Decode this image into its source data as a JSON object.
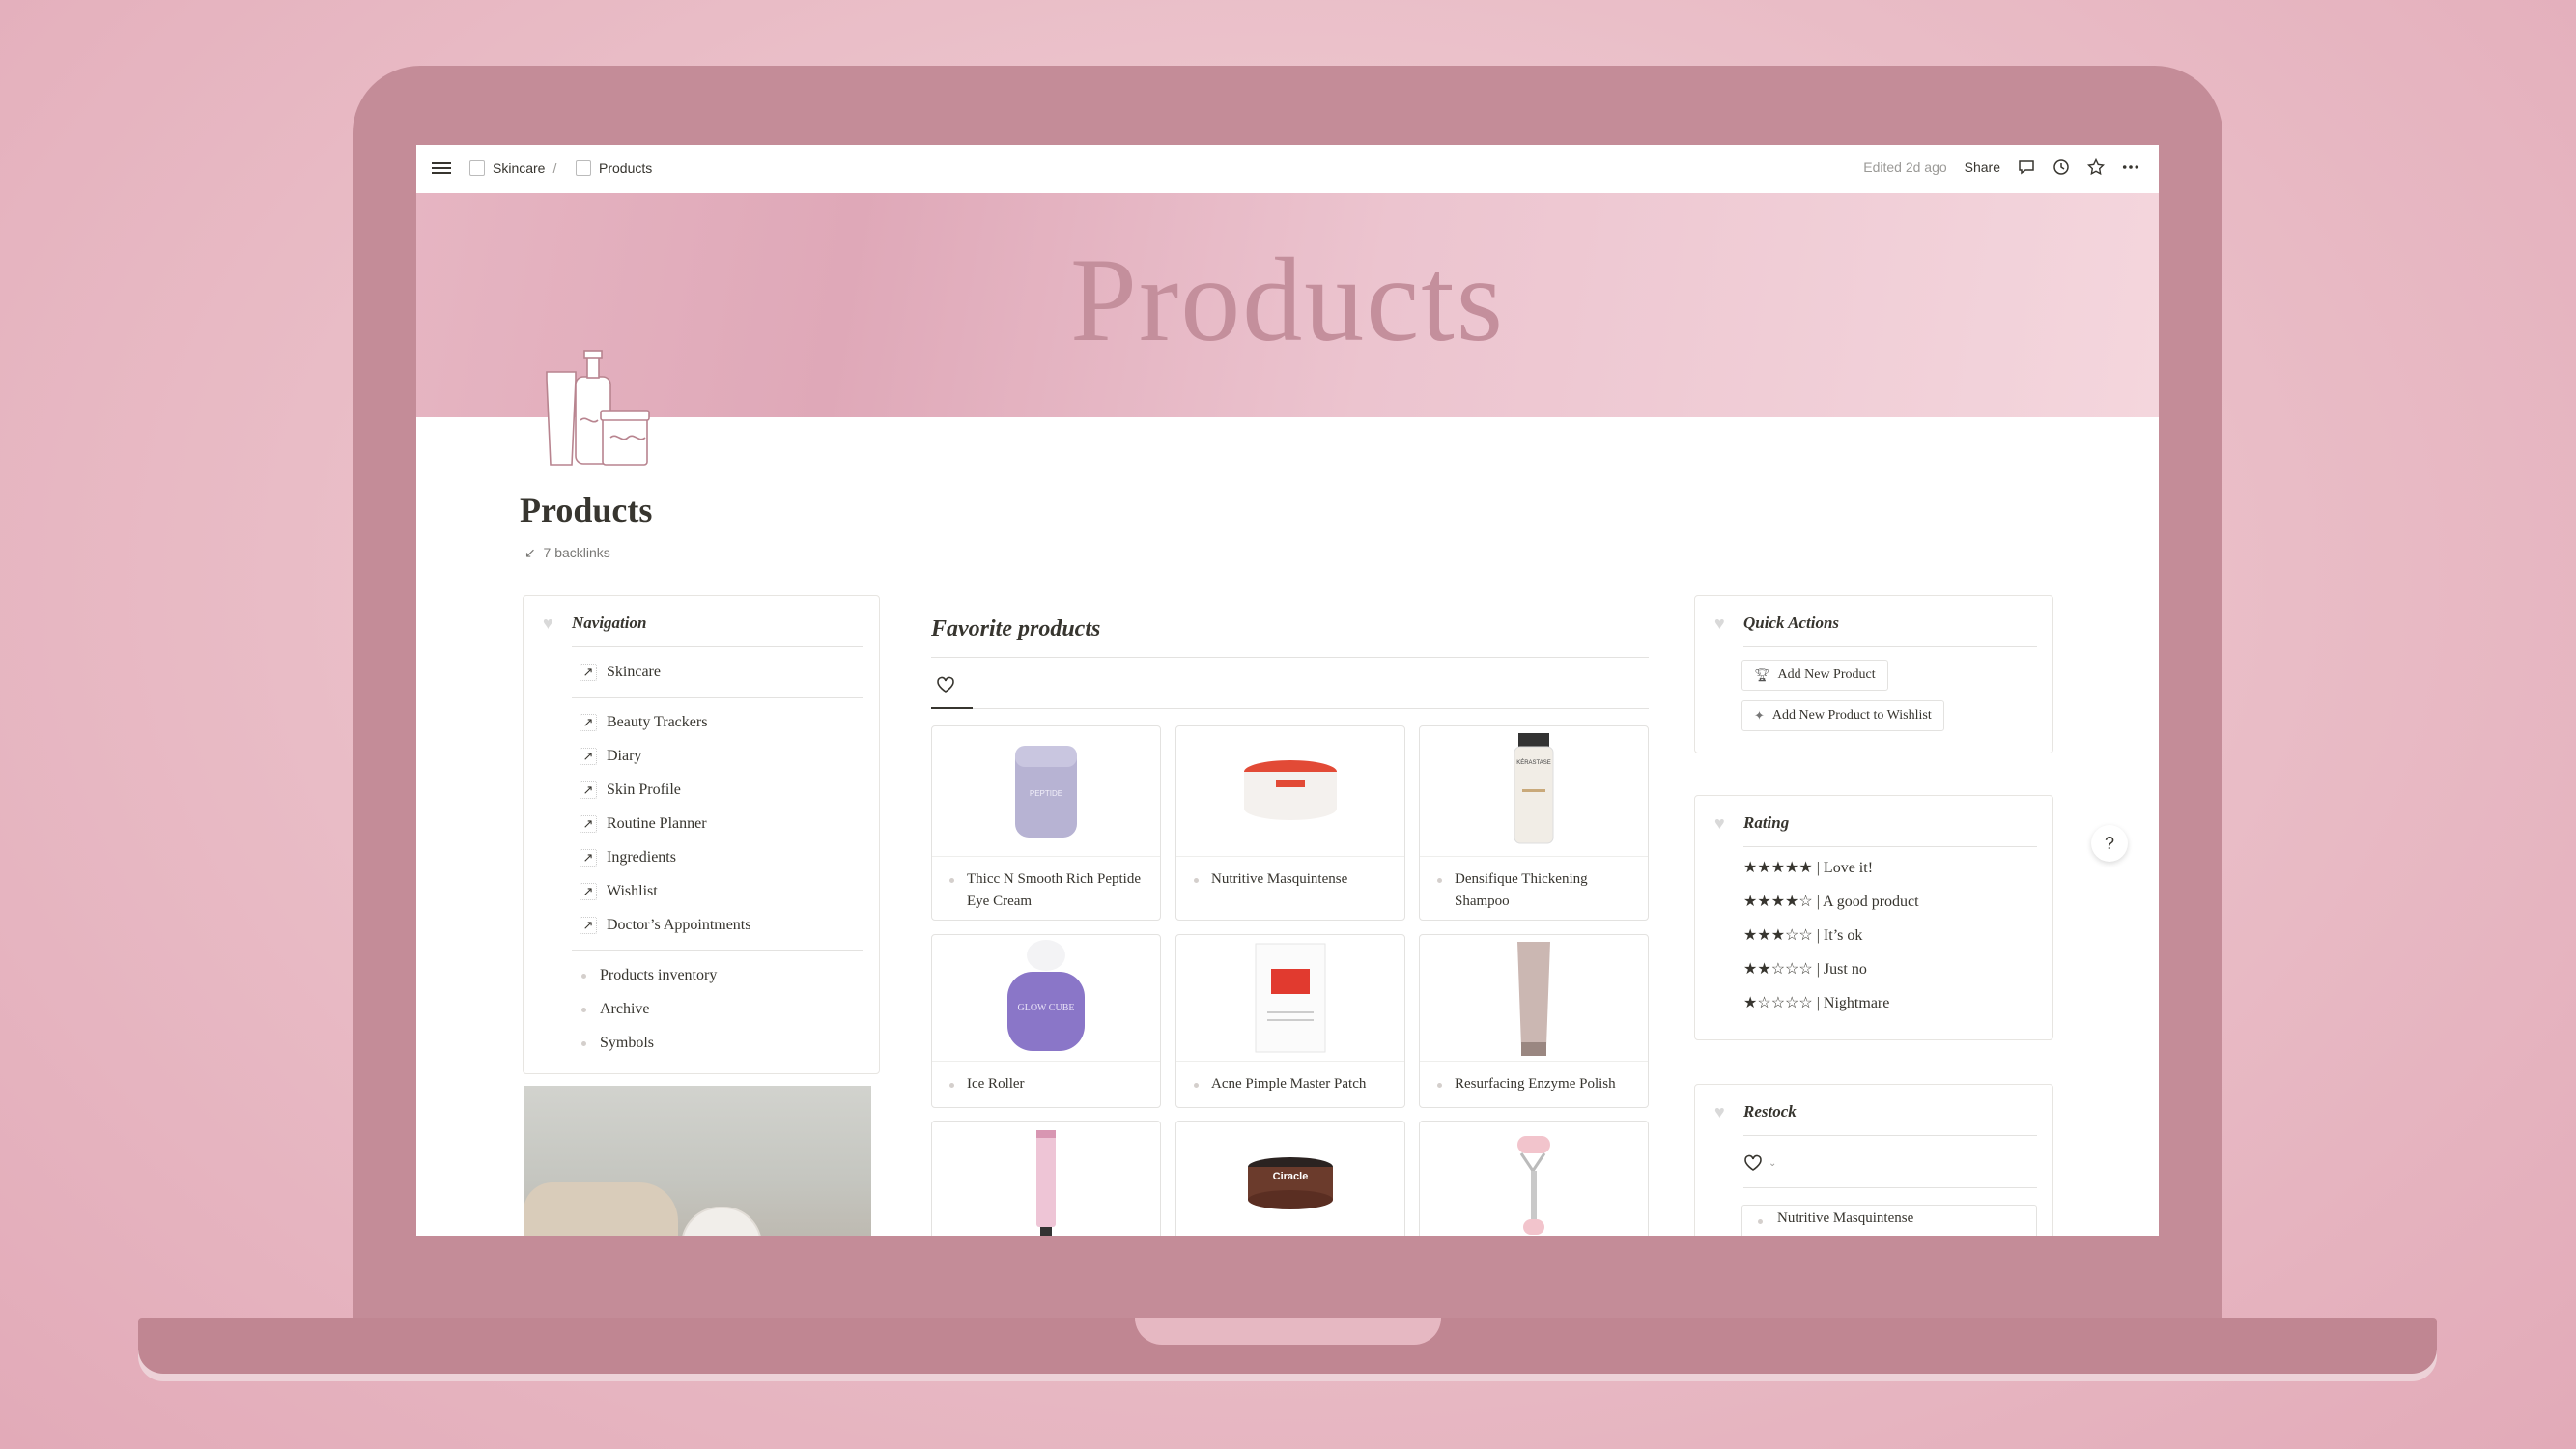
{
  "topbar": {
    "breadcrumb": [
      "Skincare",
      "Products"
    ],
    "separator": "/",
    "edited": "Edited 2d ago",
    "share": "Share"
  },
  "cover": {
    "title": "Products"
  },
  "page": {
    "title": "Products",
    "backlinks": "7 backlinks"
  },
  "navigation": {
    "heading": "Navigation",
    "top_link": "Skincare",
    "links": [
      "Beauty Trackers",
      "Diary",
      "Skin Profile",
      "Routine Planner",
      "Ingredients",
      "Wishlist",
      "Doctor’s Appointments"
    ],
    "bullets": [
      "Products inventory",
      "Archive",
      "Symbols"
    ]
  },
  "favorites": {
    "title": "Favorite products",
    "cards": [
      {
        "name": "Thicc N Smooth Rich Peptide Eye Cream"
      },
      {
        "name": "Nutritive Masquintense"
      },
      {
        "name": "Densifique Thickening Shampoo"
      },
      {
        "name": "Ice Roller"
      },
      {
        "name": "Acne Pimple Master Patch"
      },
      {
        "name": "Resurfacing Enzyme Polish"
      },
      {
        "name": ""
      },
      {
        "name": ""
      },
      {
        "name": ""
      }
    ],
    "product_labels": {
      "eye_cream": "PEPTIDE",
      "glow": "GLOW CUBE",
      "kerastase": "KÉRASTASE",
      "ciracle": "Ciracle"
    }
  },
  "quick_actions": {
    "heading": "Quick Actions",
    "buttons": [
      "Add New Product",
      "Add New Product to Wishlist"
    ]
  },
  "rating": {
    "heading": "Rating",
    "items": [
      "★★★★★ | Love it!",
      "★★★★☆ | A good product",
      "★★★☆☆ | It’s ok",
      "★★☆☆☆ | Just no",
      "★☆☆☆☆ | Nightmare"
    ]
  },
  "restock": {
    "heading": "Restock",
    "items": [
      "Nutritive Masquintense"
    ]
  },
  "help": {
    "label": "?"
  },
  "colors": {
    "accent": "#c48c98",
    "cover": "#e6b5c2",
    "text": "#37352f"
  }
}
